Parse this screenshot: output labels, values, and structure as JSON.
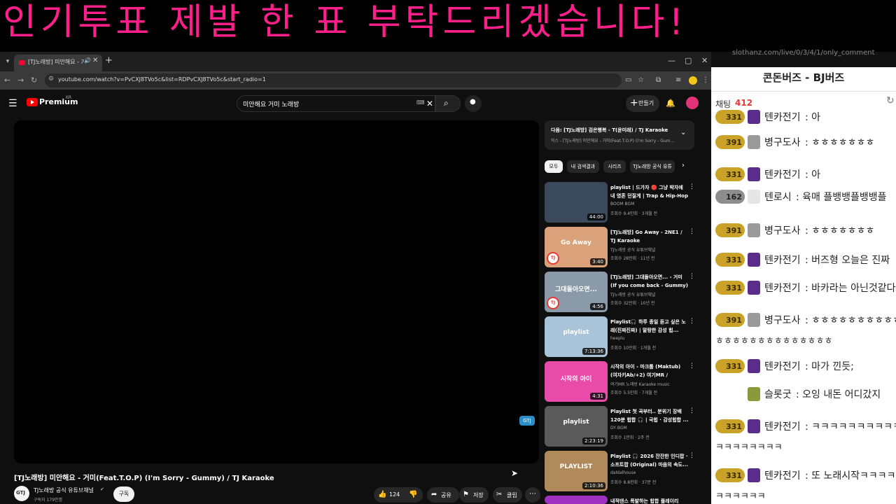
{
  "banner": {
    "text": "인기투표 제발 한 표 부탁드리겠습니다!"
  },
  "browser": {
    "tab_title": "[TJ노래방] 미안해요 - 거미",
    "tab_audio": "🔊",
    "tab_close": "✕",
    "new_tab": "+",
    "min": "—",
    "max": "▢",
    "close": "✕",
    "back": "←",
    "forward": "→",
    "reload": "↻",
    "url": "youtube.com/watch?v=PvCXJ8TVo5c&list=RDPvCXJ8TVo5c&start_radio=1"
  },
  "youtube": {
    "brand": "Premium",
    "region": "KR",
    "search_value": "미안해요 거미 노래방",
    "create_label": "만들기",
    "video_title": "[TJ노래방] 미안해요 - 거미(Feat.T.O.P) (I'm Sorry - Gummy) / TJ Karaoke",
    "channel_initials": "GTJ",
    "channel_name": "TJ노래방 공식 유튜브채널",
    "channel_subs": "구독자 179만명",
    "subscribe": "구독",
    "like_count": "124",
    "share": "공유",
    "save": "저장",
    "clip": "클립",
    "watermark": "GTJ"
  },
  "up_next": {
    "title": "다음: [TJ노래방] 검은행복 - T(윤미래) / TJ Karaoke",
    "subtitle": "믹스 - [TJ노래방] 미안해요 - 거미(Feat.T.O.P) (I'm Sorry - Gum..."
  },
  "chips": [
    "모두",
    "내 검색결과",
    "시리즈",
    "TJ노래방 공식 유튜"
  ],
  "recommendations": [
    {
      "title": "playlist | 드가자 🔴 그냥 박자에 내 영혼 던질게 | Trap & Hip-Hop",
      "channel": "BOOM BGM",
      "meta": "조회수 9.4만회 · 3개월 전",
      "duration": "44:00",
      "thumb_text": "",
      "color": "#3a4a5a",
      "tj": false
    },
    {
      "title": "[TJ노래방] Go Away - 2NE1 / TJ Karaoke",
      "channel": "TJ노래방 공식 유튜브채널",
      "meta": "조회수 28만회 · 11년 전",
      "duration": "3:40",
      "thumb_text": "Go Away",
      "color": "#d9a27a",
      "tj": true
    },
    {
      "title": "[TJ노래방] 그대돌아오면... - 거미 (If you come back - Gummy) / T...",
      "channel": "TJ노래방 공식 유튜브채널",
      "meta": "조회수 32만회 · 10년 전",
      "duration": "4:56",
      "thumb_text": "그대돌아오면...",
      "color": "#8a9aa8",
      "tj": true
    },
    {
      "title": "Playlist🎧 하루 종일 듣고 싶은 노래(진짜진짜) | 말랑한 감성 힙...",
      "channel": "heeplu",
      "meta": "조회수 10만회 · 1개월 전",
      "duration": "7:13:36",
      "thumb_text": "playlist",
      "color": "#a9c4d8",
      "tj": false
    },
    {
      "title": "시작의 아이 - 마크툽 (Maktub) (여자키Ab/+2) 여기MR / Karaoke /...",
      "channel": "여기MR 노래방 Karaoke music",
      "meta": "조회수 5.5만회 · 7개월 전",
      "duration": "4:31",
      "thumb_text": "시작의 아이",
      "color": "#e84ba8",
      "tj": false
    },
    {
      "title": "Playlist 첫 곡부터.. 분위기 장배 120분 힙합 🎧 | 국힙 · 감성힙합 ...",
      "channel": "DY BGM",
      "meta": "조회수 1만회 · 2주 전",
      "duration": "2:23:19",
      "thumb_text": "playlist",
      "color": "#5a5a5a",
      "tj": false
    },
    {
      "title": "Playlist 🎧 2026 잔잔한 인디팝 · 소프트팝 (Original) 마음의 속도...",
      "channel": "daldalhouse",
      "meta": "조회수 8.8천회 · 37분 전",
      "duration": "2:10:36",
      "thumb_text": "PLAYLIST",
      "color": "#b08a5a",
      "tj": false
    }
  ],
  "rec_partial": "내적댄스 폭발하는 힙합 플레이리",
  "chat": {
    "url": "slothanz.com/live/0/3/4/1/only_comment",
    "title": "콘돈버즈 - BJ버즈",
    "label": "채팅",
    "count": "412",
    "refresh": "↻",
    "messages": [
      {
        "badge": "331",
        "badge_type": "gold",
        "icon": "purple",
        "name": "텐카전기",
        "text": "아"
      },
      {
        "badge": "391",
        "badge_type": "gold",
        "icon": "gray",
        "name": "병구도사",
        "text": "ㅎㅎㅎㅎㅎㅎㅎ"
      },
      {
        "badge": "331",
        "badge_type": "gold",
        "icon": "purple",
        "name": "텐카전기",
        "text": "아"
      },
      {
        "badge": "162",
        "badge_type": "silver",
        "icon": "light",
        "name": "텐로시",
        "text": "육매 플뱅뱅플뱅뱅플"
      },
      {
        "badge": "391",
        "badge_type": "gold",
        "icon": "gray",
        "name": "병구도사",
        "text": "ㅎㅎㅎㅎㅎㅎㅎ"
      },
      {
        "badge": "331",
        "badge_type": "gold",
        "icon": "purple",
        "name": "텐카전기",
        "text": "버즈형 오늘은 진짜"
      },
      {
        "badge": "331",
        "badge_type": "gold",
        "icon": "purple",
        "name": "텐카전기",
        "text": "바카라는 아닌것같다"
      },
      {
        "badge": "391",
        "badge_type": "gold",
        "icon": "gray",
        "name": "병구도사",
        "text": "ㅎㅎㅎㅎㅎㅎㅎㅎㅎㅎ",
        "cont": "ㅎㅎㅎㅎㅎㅎㅎㅎㅎㅎㅎㅎㅎㅎ"
      },
      {
        "badge": "331",
        "badge_type": "gold",
        "icon": "purple",
        "name": "텐카전기",
        "text": "마가 낀듯;"
      },
      {
        "badge": "",
        "badge_type": "none",
        "icon": "green",
        "name": "슬롯굿",
        "text": "오잉 내돈 어디갔지"
      },
      {
        "badge": "331",
        "badge_type": "gold",
        "icon": "purple",
        "name": "텐카전기",
        "text": "ㅋㅋㅋㅋㅋㅋㅋㅋㅋㅋ",
        "cont": "ㅋㅋㅋㅋㅋㅋㅋㅋ"
      },
      {
        "badge": "331",
        "badge_type": "gold",
        "icon": "purple",
        "name": "텐카전기",
        "text": "또 노래시작ㅋㅋㅋㅋ",
        "cont": "ㅋㅋㅋㅋㅋㅋ"
      }
    ]
  }
}
